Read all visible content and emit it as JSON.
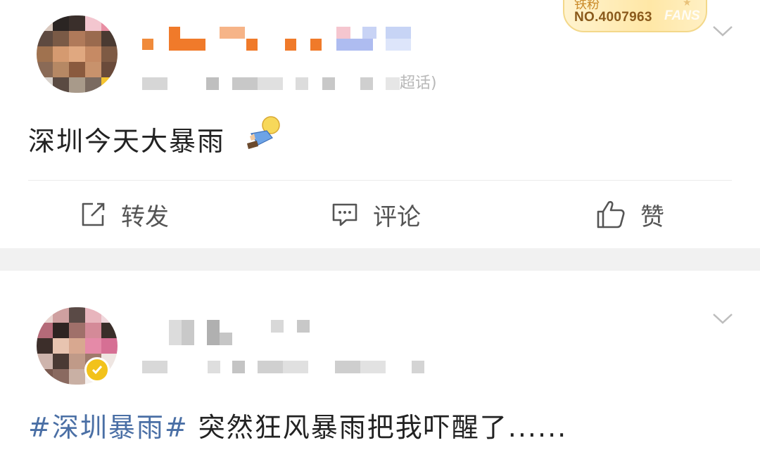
{
  "post1": {
    "fan_badge": {
      "title": "铁粉",
      "number": "NO.4007963",
      "fans": "FANS"
    },
    "meta_suffix": "超话)",
    "text": "深圳今天大暴雨",
    "emoji": "rain-person-emoji",
    "actions": {
      "repost": "转发",
      "comment": "评论",
      "like": "赞"
    }
  },
  "post2": {
    "hashtag": "#深圳暴雨#",
    "text": " 突然狂风暴雨把我吓醒了......"
  },
  "colors": {
    "hashtag": "#4a6fa5",
    "orange_name_blocks": "#f07a2a",
    "verified_badge": "#f2c21b",
    "separator_band": "#f1f1f1"
  }
}
